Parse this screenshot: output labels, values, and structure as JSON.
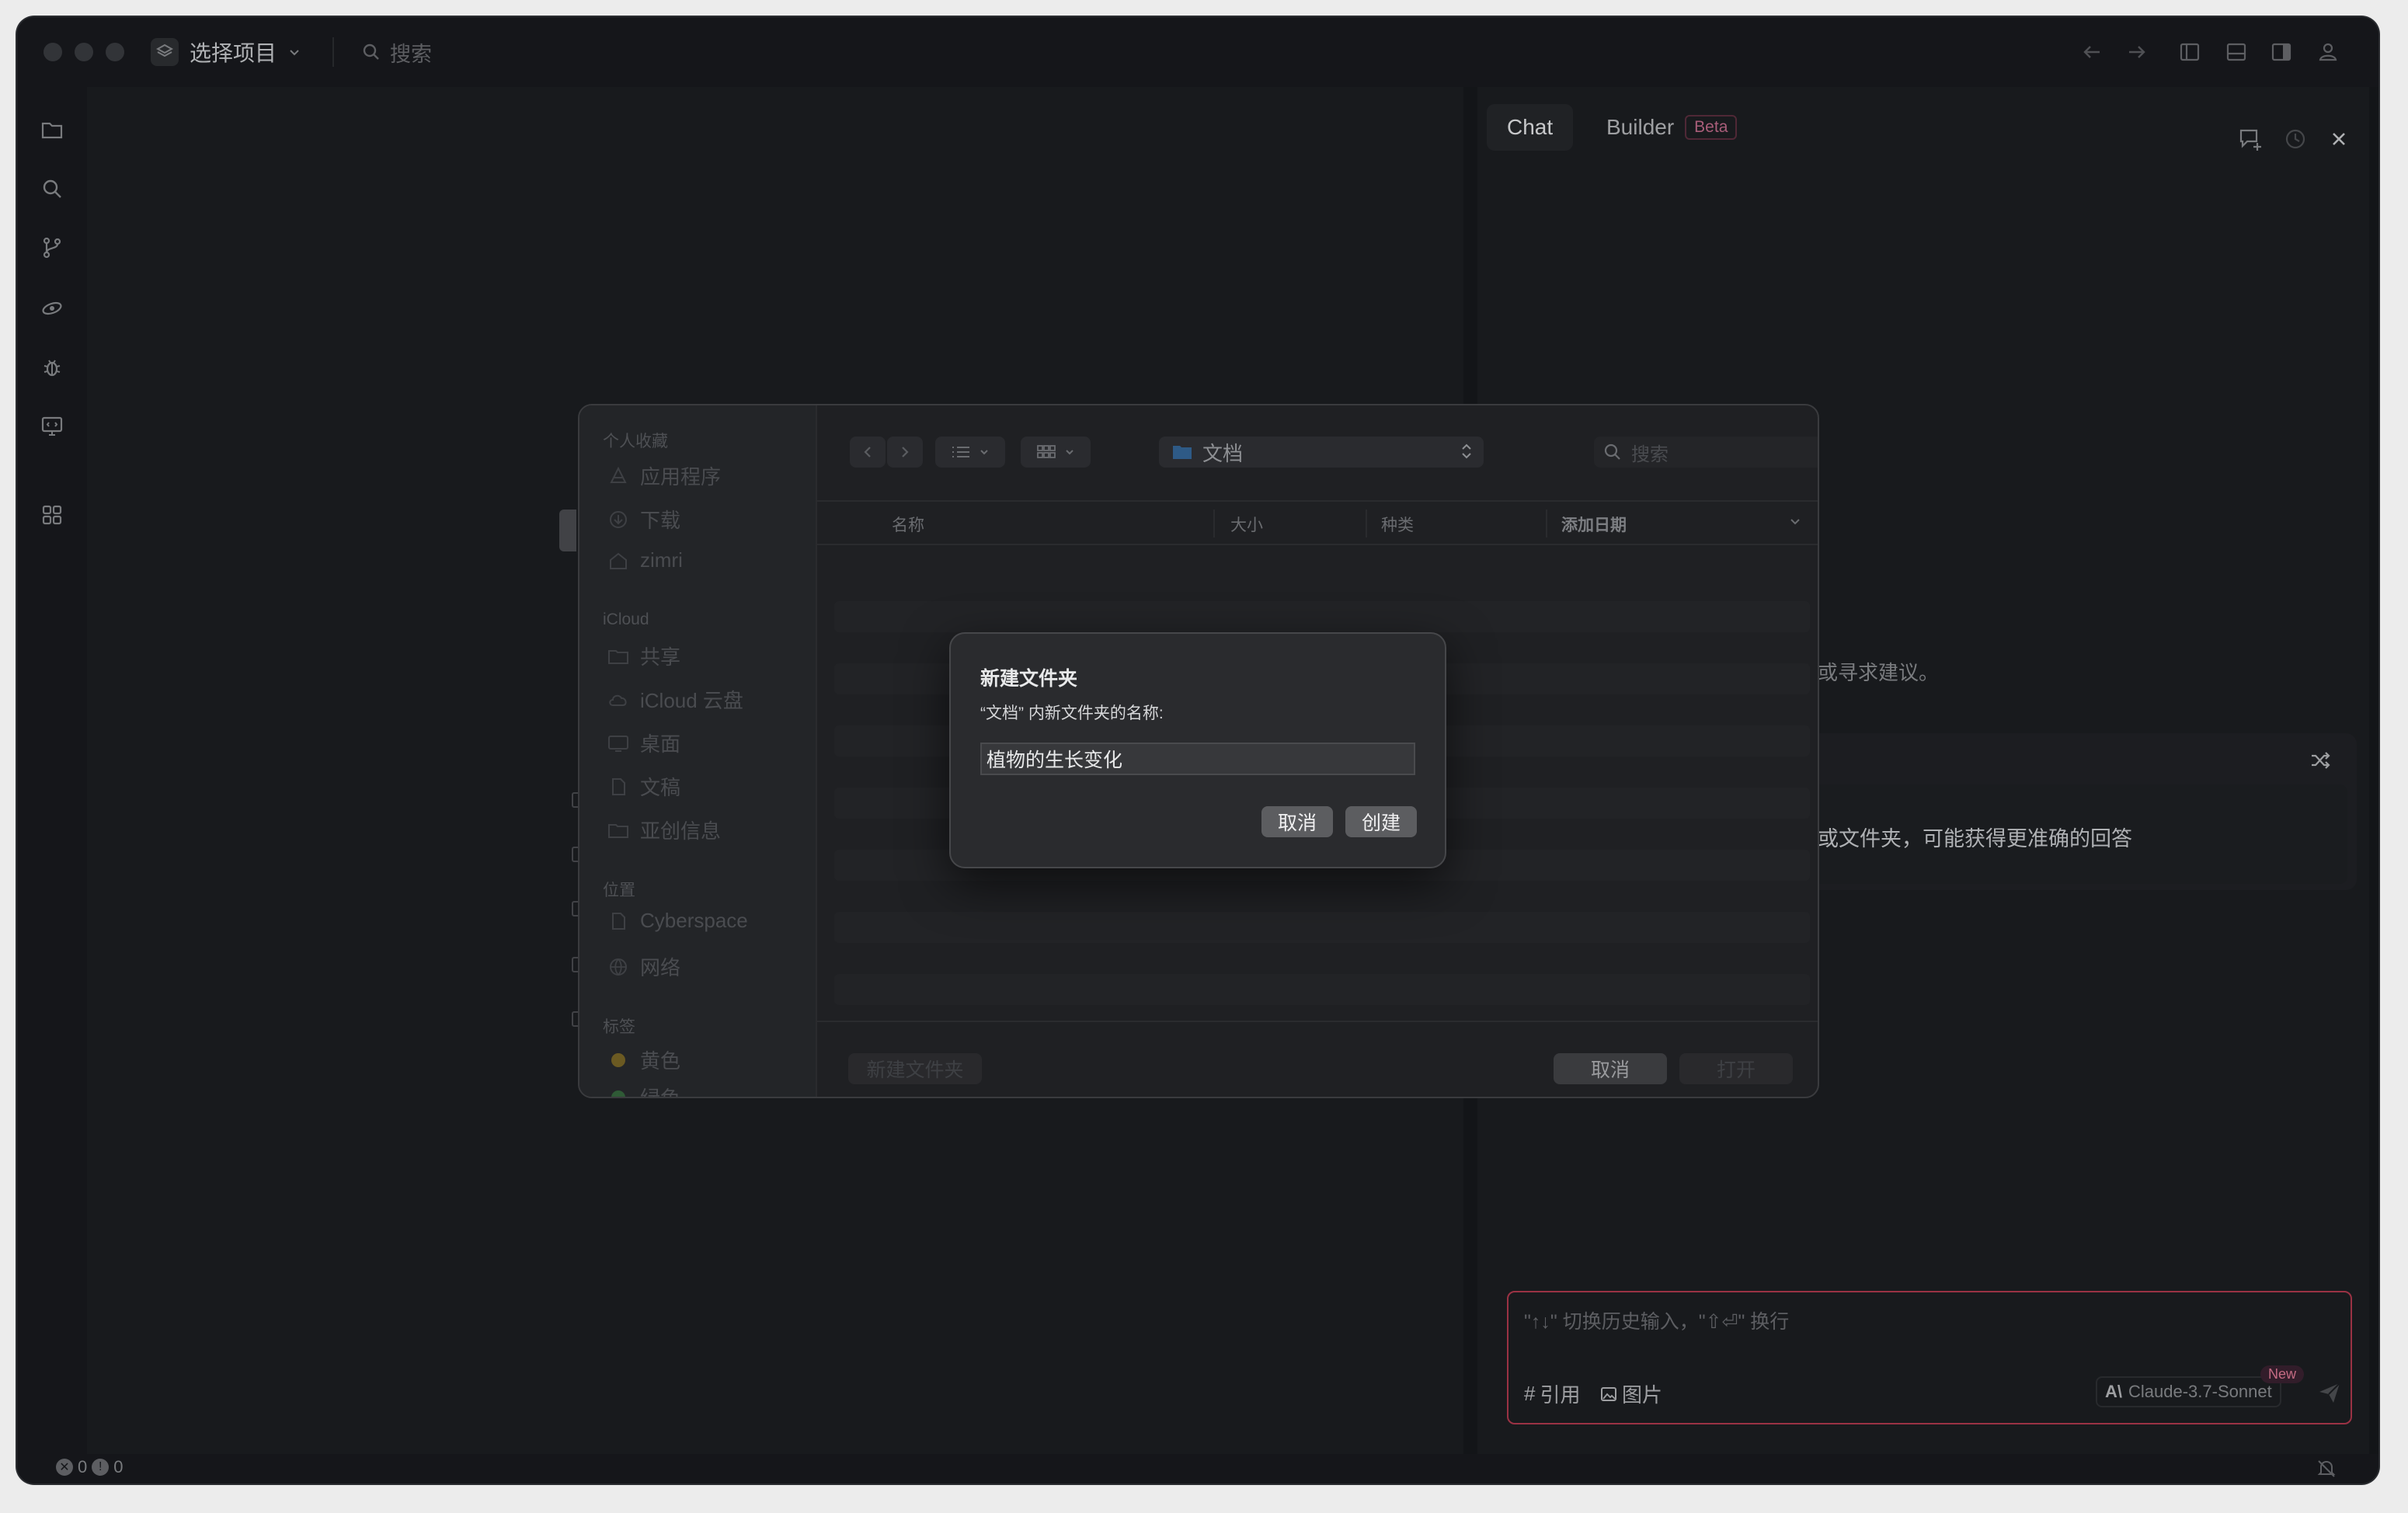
{
  "titlebar": {
    "project_label": "选择项目",
    "search_label": "搜索"
  },
  "chat": {
    "tabs": [
      {
        "label": "Chat"
      },
      {
        "label": "Builder",
        "badge": "Beta"
      }
    ],
    "hint_partial": "或寻求建议。",
    "suggestion_partial": "或文件夹，可能获得更准确的回答",
    "input_placeholder": "\"↑↓\" 切换历史输入，\"⇧⏎\" 换行",
    "ref_label": "引用",
    "image_label": "图片",
    "model_label": "Claude-3.7-Sonnet",
    "new_badge": "New"
  },
  "status": {
    "errors": "0",
    "warnings": "0"
  },
  "file_dialog": {
    "sidebar": {
      "favorites_header": "个人收藏",
      "favorites": [
        "应用程序",
        "下载",
        "zimri"
      ],
      "icloud_header": "iCloud",
      "icloud": [
        "共享",
        "iCloud 云盘",
        "桌面",
        "文稿",
        "亚创信息"
      ],
      "locations_header": "位置",
      "locations": [
        "Cyberspace",
        "网络"
      ],
      "tags_header": "标签",
      "tags": [
        "黄色",
        "绿色"
      ]
    },
    "path": "文档",
    "search_placeholder": "搜索",
    "columns": [
      "名称",
      "大小",
      "种类",
      "添加日期"
    ],
    "new_folder_button": "新建文件夹",
    "cancel_button": "取消",
    "open_button": "打开"
  },
  "alert": {
    "title": "新建文件夹",
    "message": "“文档” 内新文件夹的名称:",
    "input_value": "植物的生长变化",
    "cancel_button": "取消",
    "create_button": "创建"
  },
  "colors": {
    "accent_border": "#b0394e",
    "new_badge": "#e07a96"
  }
}
